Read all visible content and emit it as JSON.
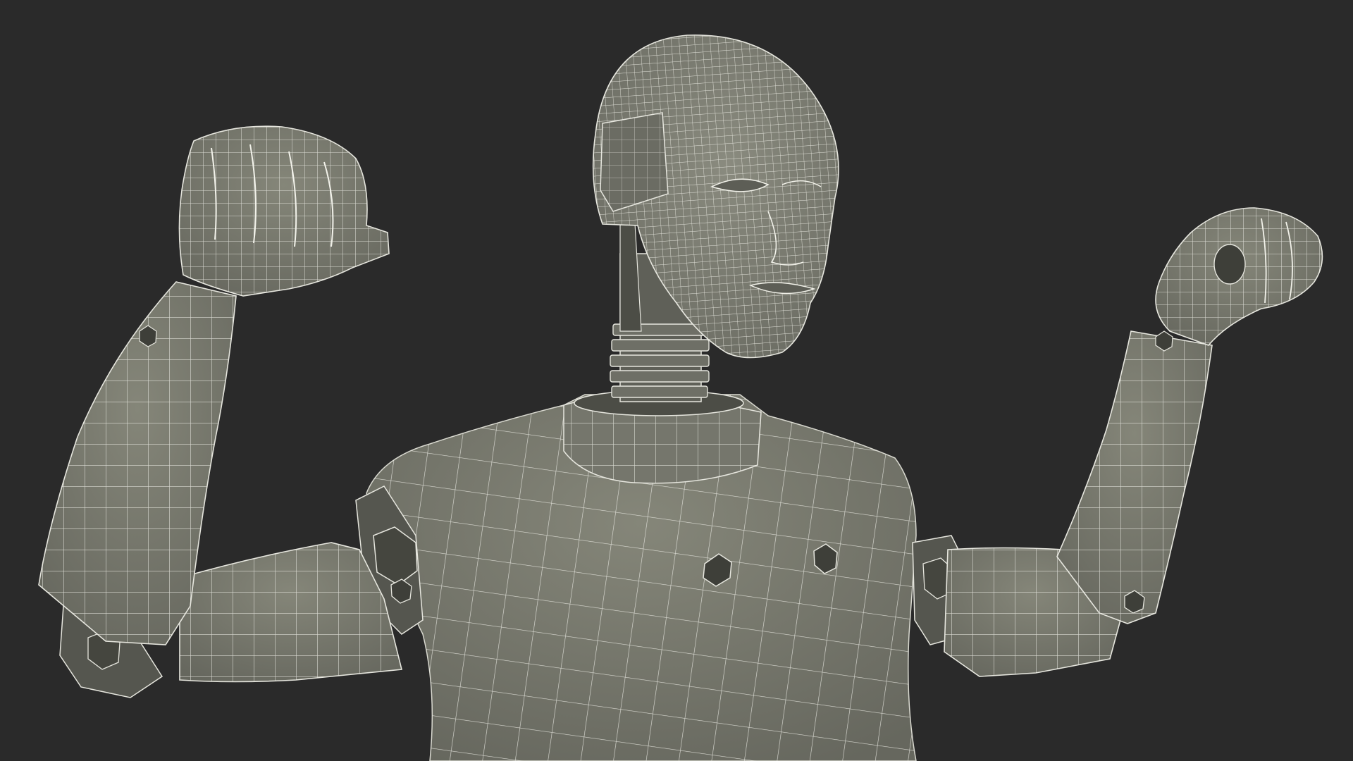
{
  "scene": {
    "background_color": "#2a2a2a",
    "mesh_fill_color": "#7b7c72",
    "mesh_shadow_color": "#5a5b53",
    "mesh_dark_color": "#3e3f39",
    "wire_color": "#eeeee6",
    "render_style": "wireframe-on-shaded",
    "subject_icon": "robot-mannequin-icon"
  }
}
